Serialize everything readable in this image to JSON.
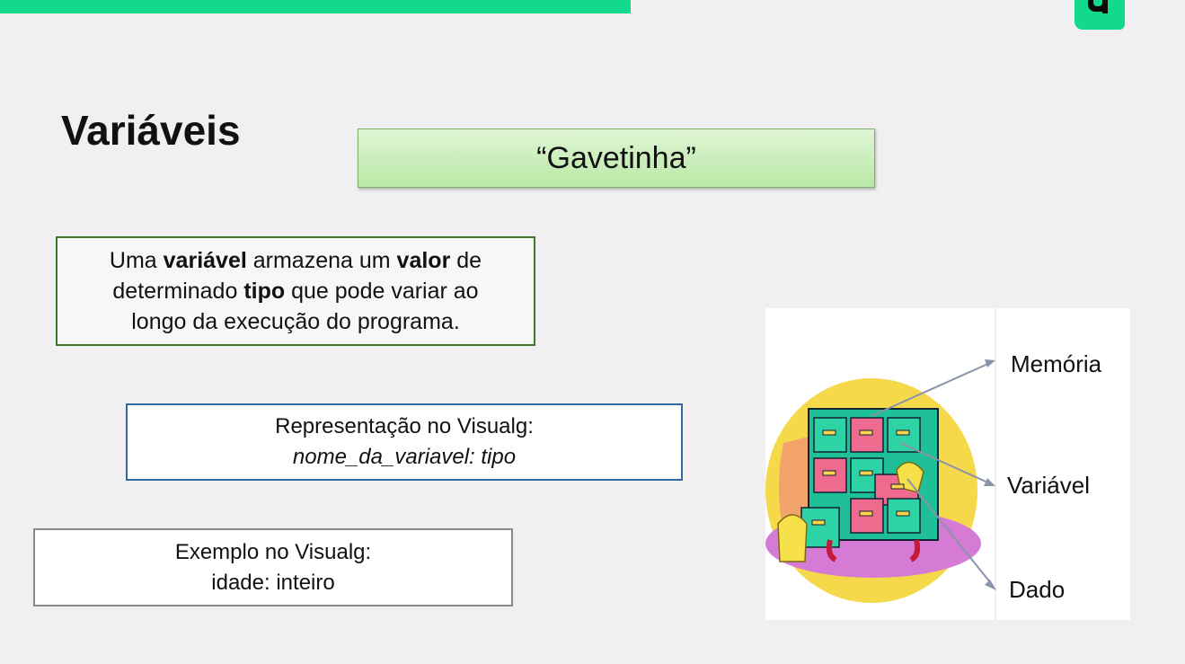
{
  "slide": {
    "title": "Variáveis",
    "banner": "“Gavetinha”"
  },
  "definition": {
    "parts": [
      {
        "text": "Uma ",
        "bold": false
      },
      {
        "text": "variável",
        "bold": true
      },
      {
        "text": " armazena um ",
        "bold": false
      },
      {
        "text": "valor",
        "bold": true
      },
      {
        "text": " de determinado ",
        "bold": false
      },
      {
        "text": "tipo",
        "bold": true
      },
      {
        "text": " que pode variar ao longo da execução do programa.",
        "bold": false
      }
    ]
  },
  "representation": {
    "heading": "Representação no Visualg:",
    "syntax": "nome_da_variavel: tipo"
  },
  "example": {
    "heading": "Exemplo no Visualg:",
    "code": "idade: inteiro"
  },
  "diagram": {
    "label_memory": "Memória",
    "label_variable": "Variável",
    "label_data": "Dado",
    "icon": "filing-cabinet-icon"
  },
  "colors": {
    "accent_green": "#12d98b",
    "definition_border": "#3c7a29",
    "representation_border": "#2e6aa6"
  }
}
